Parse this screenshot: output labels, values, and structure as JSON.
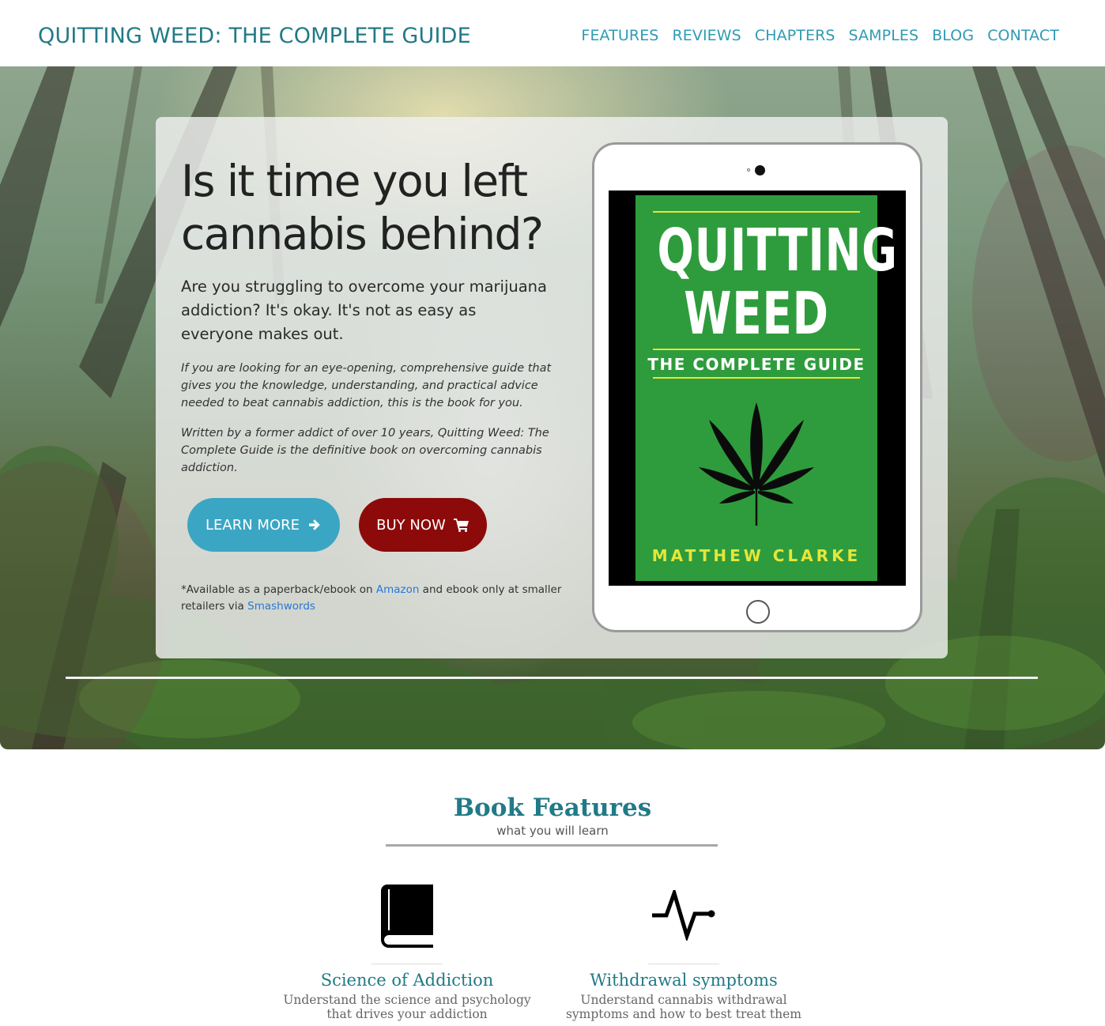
{
  "brand": "QUITTING WEED: THE COMPLETE GUIDE",
  "nav": {
    "items": [
      "FEATURES",
      "REVIEWS",
      "CHAPTERS",
      "SAMPLES",
      "BLOG",
      "CONTACT"
    ]
  },
  "hero": {
    "title": "Is it time you left cannabis behind?",
    "lead": "Are you struggling to overcome your marijuana addiction? It's okay. It's not as easy as everyone makes out.",
    "p1": "If you are looking for an eye-opening, comprehensive guide that gives you the knowledge, understanding, and practical advice needed to beat cannabis addiction, this is the book for you.",
    "p2": "Written by a former addict of over 10 years, Quitting Weed: The Complete Guide is the definitive book on overcoming cannabis addiction.",
    "learn_more": "LEARN MORE",
    "buy_now": "BUY NOW",
    "avail_prefix": "*Available as a paperback/ebook on ",
    "avail_link1": "Amazon",
    "avail_mid": " and ebook only at smaller retailers via ",
    "avail_link2": "Smashwords"
  },
  "cover": {
    "title_line1": "QUITTING",
    "title_line2": "WEED",
    "subtitle": "THE COMPLETE GUIDE",
    "author": "MATTHEW CLARKE"
  },
  "features": {
    "title": "Book Features",
    "subtitle": "what you will learn",
    "items": [
      {
        "icon": "book-icon",
        "title": "Science of Addiction",
        "desc": "Understand the science and psychology that drives your addiction"
      },
      {
        "icon": "pulse-icon",
        "title": "Withdrawal symptoms",
        "desc": "Understand cannabis withdrawal symptoms and how to best treat them"
      }
    ]
  },
  "colors": {
    "brand": "#217a87",
    "nav_link": "#2f9bb3",
    "learn_button": "#3aa6c4",
    "buy_button": "#8d0a0a",
    "cover_green": "#2e9c3c",
    "cover_accent": "#e6e63a"
  }
}
